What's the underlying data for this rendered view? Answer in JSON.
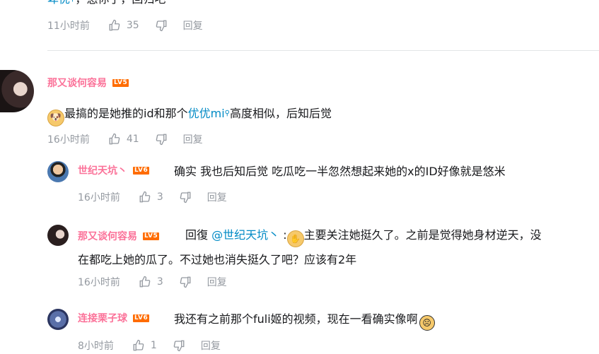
{
  "top_comment": {
    "partial_text_link": "卑优",
    "partial_text": "，悠你了，回归吧",
    "time": "11小时前",
    "likes": "35",
    "reply_label": "回复"
  },
  "comment": {
    "username": "那又谈何容易",
    "level": "LV5",
    "emoji": "doge",
    "text_before": "最搞的是她推的id和那个",
    "link_text": "优优mi",
    "text_after": "高度相似，后知后觉",
    "time": "16小时前",
    "likes": "41",
    "reply_label": "回复"
  },
  "replies": [
    {
      "username": "世纪天坑丶",
      "level": "LV6",
      "text": "确实 我也后知后觉 吃瓜吃一半忽然想起来她的x的ID好像就是悠米",
      "time": "16小时前",
      "likes": "3",
      "reply_label": "回复"
    },
    {
      "username": "那又谈何容易",
      "level": "LV5",
      "prefix": "回復",
      "mention": "@世纪天坑丶",
      "colon": " :",
      "line1": "主要关注她挺久了。之前是觉得她身材逆天，没",
      "line2": "在都吃上她的瓜了。不过她也消失挺久了吧？应该有2年",
      "time": "16小时前",
      "likes": "3",
      "reply_label": "回复"
    },
    {
      "username": "连接栗子球",
      "level": "LV6",
      "text": "我还有之前那个fuli姬的视频，现在一看确实像啊",
      "time": "8小时前",
      "likes": "1",
      "reply_label": "回复"
    }
  ],
  "colors": {
    "username": "#fb7299",
    "link": "#008ac5",
    "meta": "#9499a0",
    "level_badge": "#ff6c00"
  }
}
